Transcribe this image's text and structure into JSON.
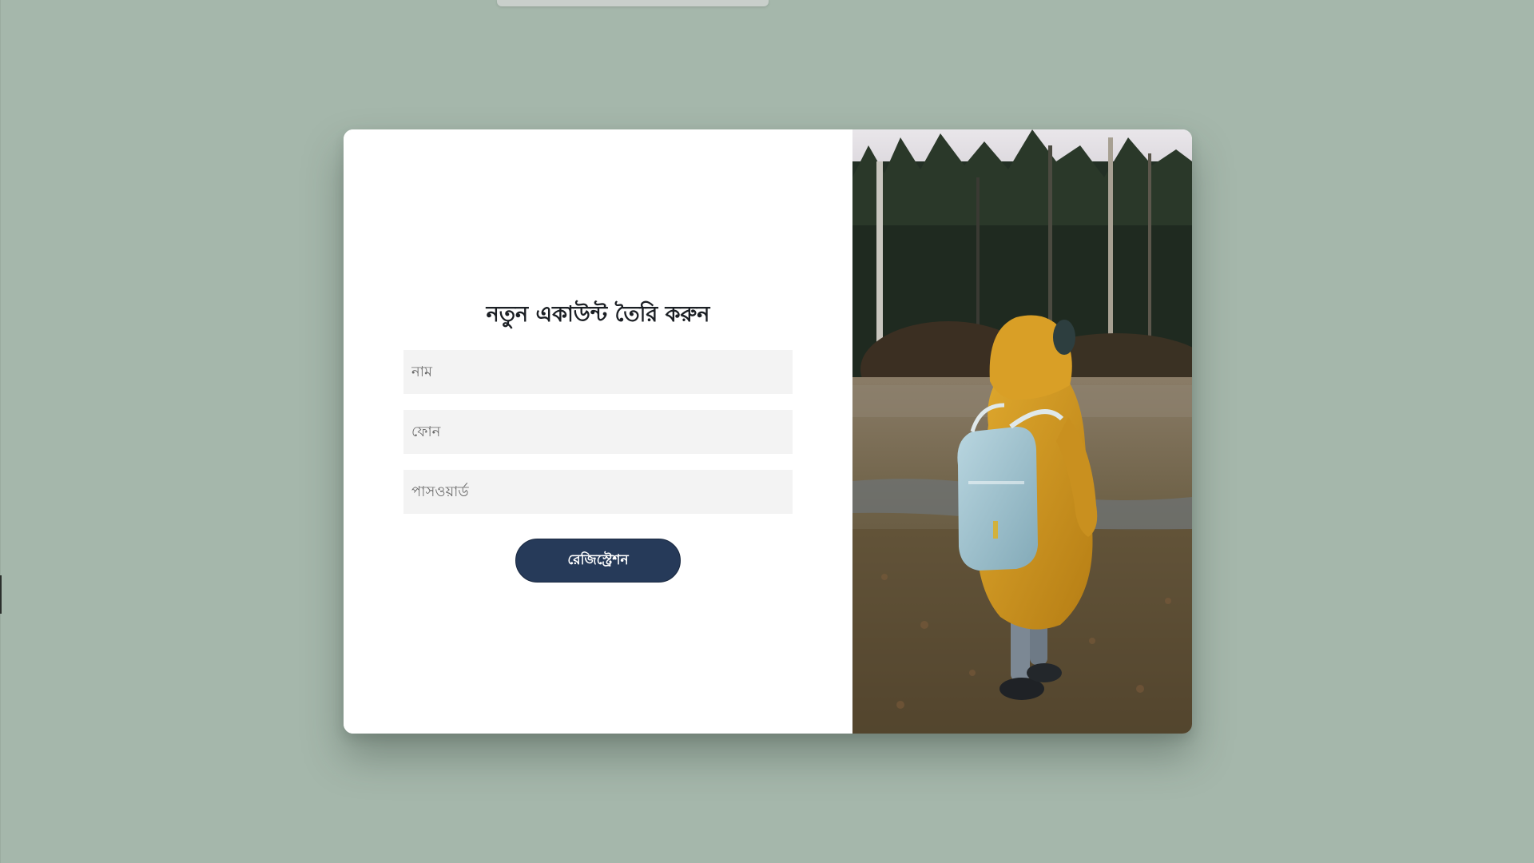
{
  "form": {
    "title": "নতুন একাউন্ট তৈরি করুন",
    "name_placeholder": "নাম",
    "phone_placeholder": "ফোন",
    "password_placeholder": "পাসওয়ার্ড",
    "submit_label": "রেজিস্ট্রেশন"
  },
  "colors": {
    "page_background": "#a5b7ab",
    "card_background": "#ffffff",
    "input_background": "#f3f3f3",
    "button_background": "#263a59",
    "button_text": "#ffffff",
    "title_text": "#1b1f24"
  },
  "image": {
    "subject": "child in yellow hooded coat with light-blue backpack walking in a park"
  }
}
